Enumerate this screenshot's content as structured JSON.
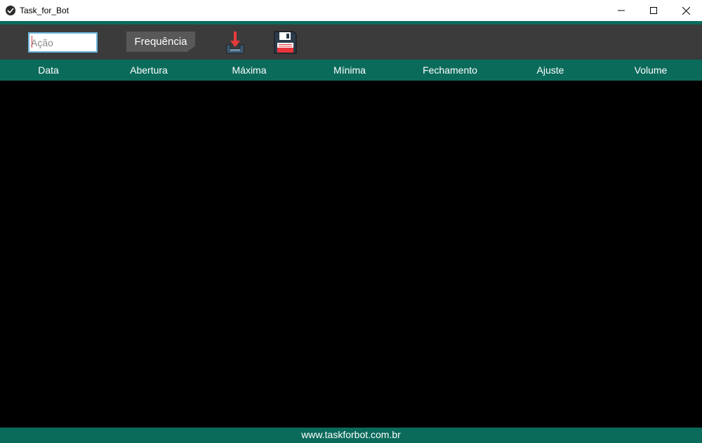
{
  "window": {
    "title": "Task_for_Bot",
    "icon": "app-logo-icon"
  },
  "toolbar": {
    "acao_placeholder": "Ação",
    "acao_value": "",
    "frequencia_label": "Frequência",
    "download_icon": "download-icon",
    "save_icon": "floppy-save-icon"
  },
  "table": {
    "columns": [
      "Data",
      "Abertura",
      "Máxima",
      "Mínima",
      "Fechamento",
      "Ajuste",
      "Volume"
    ],
    "rows": []
  },
  "footer": {
    "url": "www.taskforbot.com.br"
  },
  "colors": {
    "accent": "#0b6b5b",
    "toolbar_bg": "#3b3b3b",
    "button_bg": "#585858",
    "body_bg": "#000000"
  }
}
